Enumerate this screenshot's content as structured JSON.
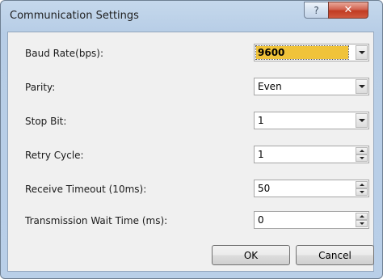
{
  "window": {
    "title": "Communication Settings",
    "help_glyph": "?",
    "close_glyph": "✕"
  },
  "settings": [
    {
      "label": "Baud Rate(bps):",
      "value": "9600",
      "control": "dropdown",
      "highlighted": true
    },
    {
      "label": "Parity:",
      "value": "Even",
      "control": "dropdown"
    },
    {
      "label": "Stop Bit:",
      "value": "1",
      "control": "dropdown"
    },
    {
      "label": "Retry Cycle:",
      "value": "1",
      "control": "spinner"
    },
    {
      "label": "Receive Timeout (10ms):",
      "value": "50",
      "control": "spinner"
    },
    {
      "label": "Transmission Wait Time (ms):",
      "value": "0",
      "control": "spinner"
    }
  ],
  "buttons": {
    "ok": "OK",
    "cancel": "Cancel"
  },
  "icons": {
    "help": "help-icon",
    "close": "close-icon",
    "dropdown": "chevron-down-icon",
    "spin_up": "spin-up-icon",
    "spin_down": "spin-down-icon"
  },
  "colors": {
    "selection_highlight": "#f0c33a",
    "close_button": "#c13b22",
    "frame": "#b9cfe8"
  }
}
